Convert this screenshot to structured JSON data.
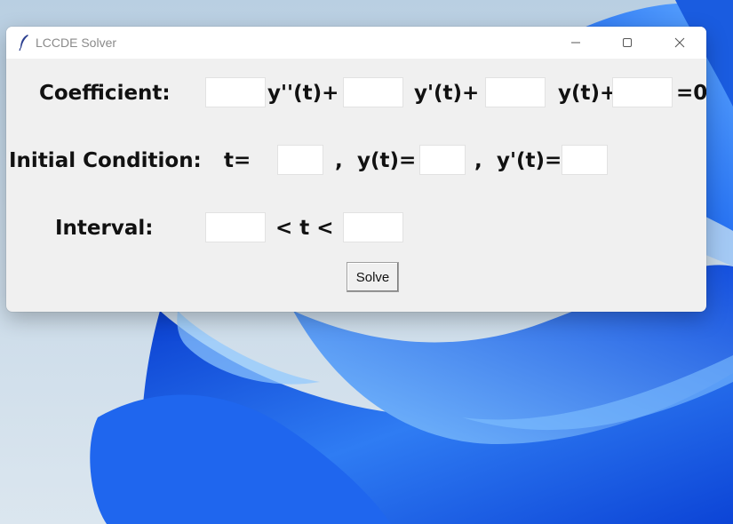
{
  "window": {
    "title": "LCCDE Solver",
    "app_icon": "feather-icon",
    "controls": [
      "minimize-icon",
      "maximize-icon",
      "close-icon"
    ]
  },
  "coefficient": {
    "label": "Coefficient:",
    "terms": [
      "y''(t)+",
      "y'(t)+",
      "y(t)+",
      "=0"
    ],
    "values": [
      "",
      "",
      "",
      ""
    ]
  },
  "initial_condition": {
    "label": "Initial Condition:",
    "t_label": "t=",
    "sep1": ",",
    "y_label": "y(t)=",
    "sep2": ",",
    "dy_label": "y'(t)=",
    "values": [
      "",
      "",
      ""
    ]
  },
  "interval": {
    "label": "Interval:",
    "between": "< t <",
    "values": [
      "",
      ""
    ]
  },
  "solve_label": "Solve",
  "colors": {
    "window_bg": "#f0f0f0",
    "titlebar_bg": "#ffffff",
    "wallpaper_blue": "#1a5ce0"
  }
}
